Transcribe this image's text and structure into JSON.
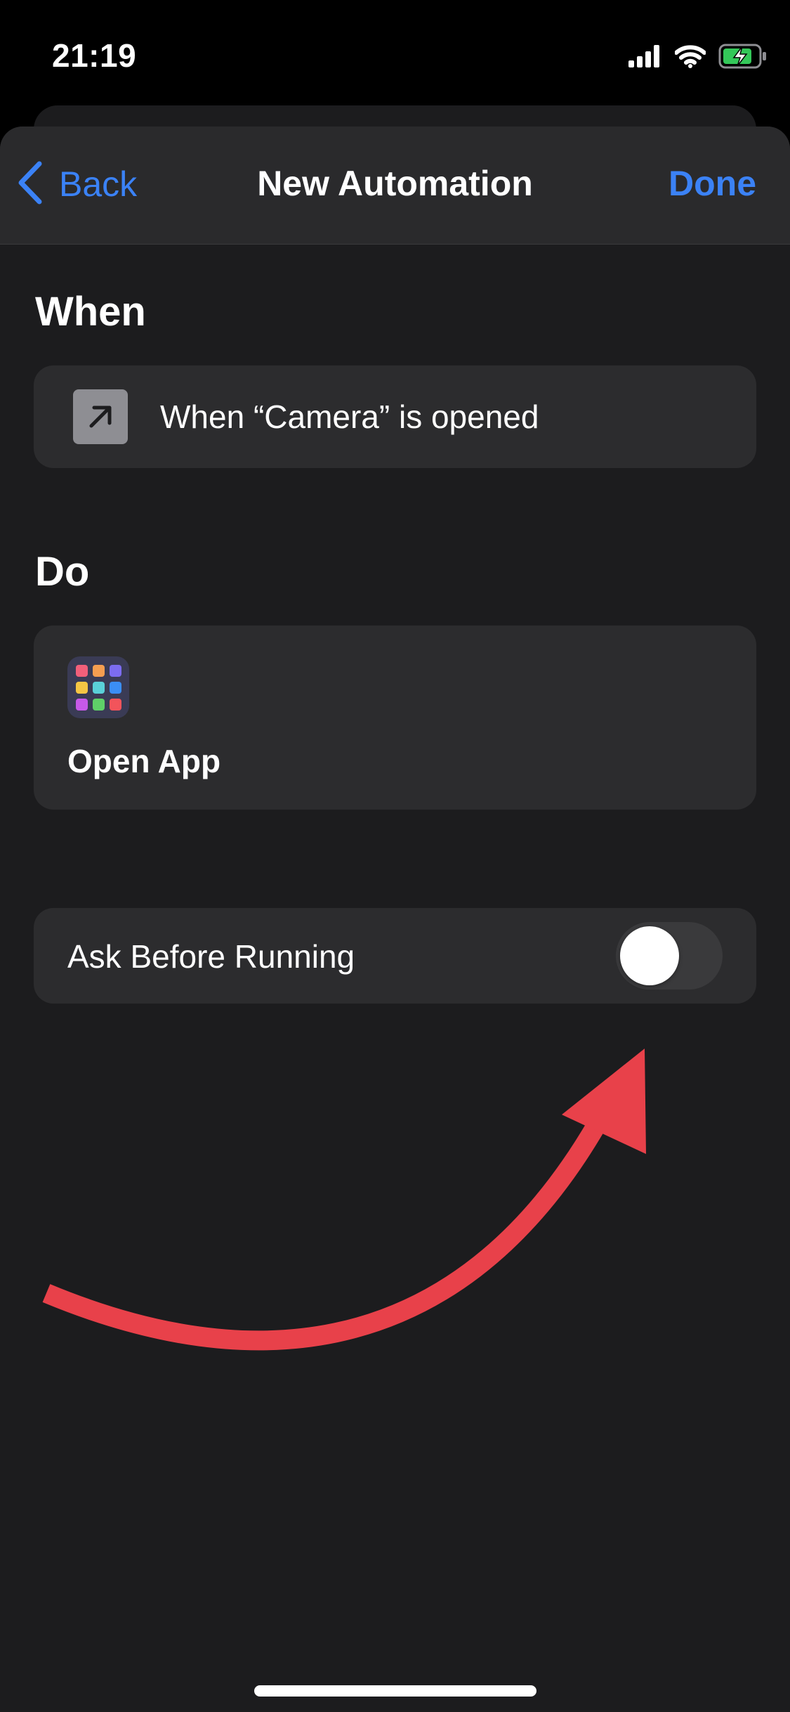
{
  "status_bar": {
    "time": "21:19",
    "icons": [
      "cellular-signal-icon",
      "wifi-icon",
      "battery-charging-icon"
    ],
    "battery_color": "#34c759"
  },
  "nav": {
    "back_label": "Back",
    "title": "New Automation",
    "done_label": "Done"
  },
  "when": {
    "title": "When",
    "trigger_text": "When “Camera” is opened",
    "trigger_icon": "app-opened-arrow-icon"
  },
  "do": {
    "title": "Do",
    "action_label": "Open App",
    "action_icon": "app-grid-icon"
  },
  "ask_before_running": {
    "label": "Ask Before Running",
    "enabled": false
  },
  "annotation": {
    "type": "arrow",
    "color": "#e8414a"
  },
  "colors": {
    "accent": "#3b82f6",
    "background": "#1c1c1e",
    "card": "#2c2c2e"
  }
}
